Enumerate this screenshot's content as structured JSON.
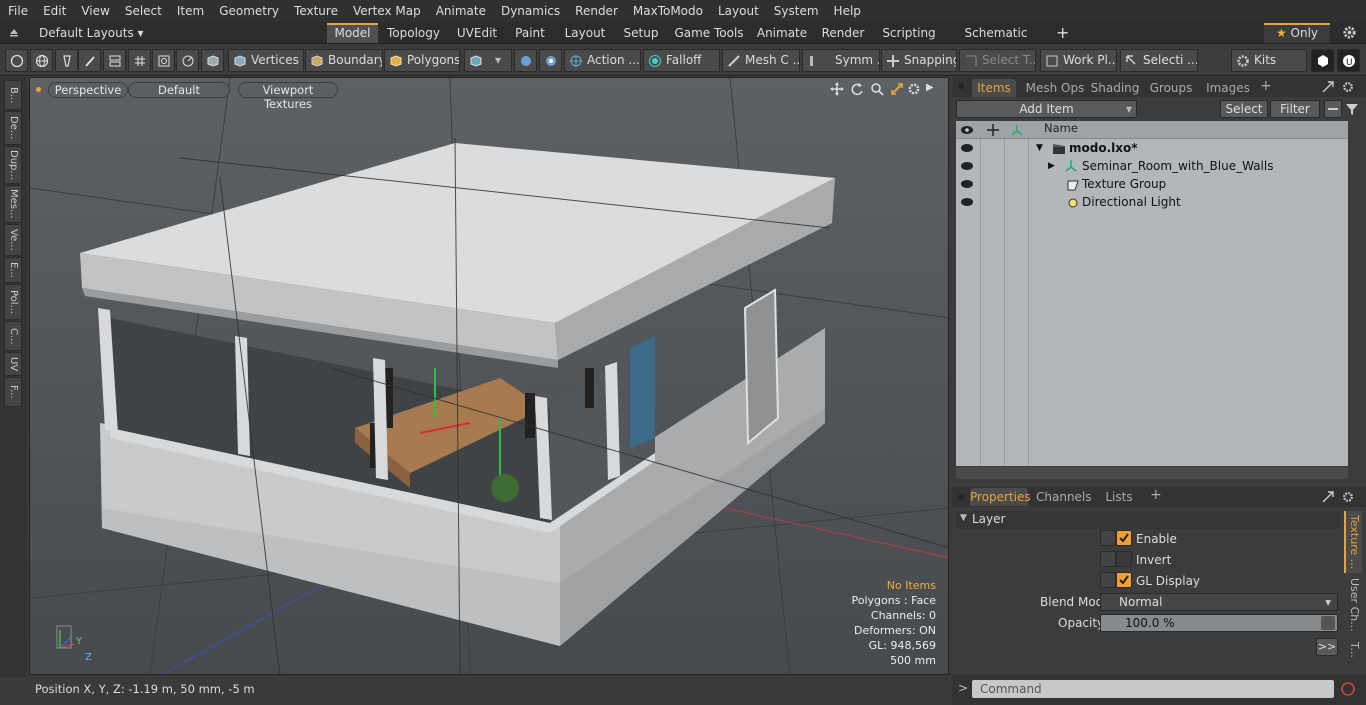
{
  "menu": [
    "File",
    "Edit",
    "View",
    "Select",
    "Item",
    "Geometry",
    "Texture",
    "Vertex Map",
    "Animate",
    "Dynamics",
    "Render",
    "MaxToModo",
    "Layout",
    "System",
    "Help"
  ],
  "layout_selector": "Default Layouts",
  "layout_tabs": [
    "Model",
    "Topology",
    "UVEdit",
    "Paint",
    "Layout",
    "Setup",
    "Game Tools",
    "Animate",
    "Render",
    "Scripting",
    "Schematic Fusion"
  ],
  "only_label": "Only",
  "toolbar": {
    "vertices": "Vertices",
    "boundary": "Boundary",
    "polygons": "Polygons",
    "action": "Action ...",
    "falloff": "Falloff",
    "mesh": "Mesh C ...",
    "symmetry": "Symm ...",
    "snapping": "Snapping",
    "select_t": "Select T...",
    "work_plane": "Work Pl...",
    "selection": "Selecti ...",
    "kits": "Kits"
  },
  "left_tabs": [
    "B...",
    "De...",
    "Dup...",
    "Mes...",
    "Ve...",
    "E...",
    "Pol...",
    "C...",
    "UV",
    "F..."
  ],
  "viewport": {
    "view_type": "Perspective",
    "shading": "Default",
    "textures": "Viewport Textures",
    "stats": [
      "No Items",
      "Polygons : Face",
      "Channels: 0",
      "Deformers: ON",
      "GL: 948,569",
      "500 mm"
    ],
    "axis_y": "Y",
    "axis_z": "Z"
  },
  "status": "Position X, Y, Z:   -1.19 m, 50 mm, -5 m",
  "items_panel": {
    "tabs": [
      "Items",
      "Mesh Ops",
      "Shading",
      "Groups",
      "Images"
    ],
    "add_item": "Add Item",
    "select": "Select",
    "filter": "Filter",
    "name_header": "Name",
    "rows": [
      "modo.lxo*",
      "Seminar_Room_with_Blue_Walls",
      "Texture Group",
      "Directional Light"
    ]
  },
  "props_panel": {
    "tabs": [
      "Properties",
      "Channels",
      "Lists"
    ],
    "section": "Layer",
    "enable": "Enable",
    "invert": "Invert",
    "gl_display": "GL Display",
    "blend_label": "Blend Mode",
    "blend_value": "Normal",
    "opacity_label": "Opacity",
    "opacity_value": "100.0 %",
    "side_tabs": [
      "Texture ...",
      "User Ch...",
      "T..."
    ],
    "more": ">>"
  },
  "command_placeholder": "Command",
  "colors": {
    "accent": "#e8a33d",
    "viewport_bg": "#525659",
    "items_bg": "#b3b7bb"
  }
}
